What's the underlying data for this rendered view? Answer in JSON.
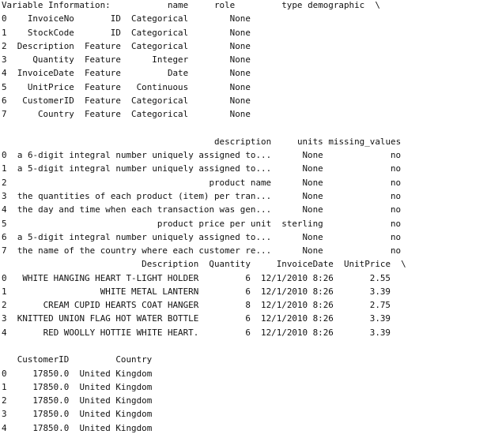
{
  "variable_info": {
    "title": "Variable Information:",
    "columns": [
      "name",
      "role",
      "type",
      "demographic"
    ],
    "continuation": "\\",
    "index": [
      "0",
      "1",
      "2",
      "3",
      "4",
      "5",
      "6",
      "7"
    ],
    "rows": [
      [
        "InvoiceNo",
        "ID",
        "Categorical",
        "None"
      ],
      [
        "StockCode",
        "ID",
        "Categorical",
        "None"
      ],
      [
        "Description",
        "Feature",
        "Categorical",
        "None"
      ],
      [
        "Quantity",
        "Feature",
        "Integer",
        "None"
      ],
      [
        "InvoiceDate",
        "Feature",
        "Date",
        "None"
      ],
      [
        "UnitPrice",
        "Feature",
        "Continuous",
        "None"
      ],
      [
        "CustomerID",
        "Feature",
        "Categorical",
        "None"
      ],
      [
        "Country",
        "Feature",
        "Categorical",
        "None"
      ]
    ]
  },
  "variable_info_cont": {
    "columns": [
      "description",
      "units",
      "missing_values"
    ],
    "index": [
      "0",
      "1",
      "2",
      "3",
      "4",
      "5",
      "6",
      "7"
    ],
    "rows": [
      [
        "a 6-digit integral number uniquely assigned to...",
        "None",
        "no"
      ],
      [
        "a 5-digit integral number uniquely assigned to...",
        "None",
        "no"
      ],
      [
        "product name",
        "None",
        "no"
      ],
      [
        "the quantities of each product (item) per tran...",
        "None",
        "no"
      ],
      [
        "the day and time when each transaction was gen...",
        "None",
        "no"
      ],
      [
        "product price per unit",
        "sterling",
        "no"
      ],
      [
        "a 5-digit integral number uniquely assigned to...",
        "None",
        "no"
      ],
      [
        "the name of the country where each customer re...",
        "None",
        "no"
      ]
    ]
  },
  "head": {
    "columns": [
      "Description",
      "Quantity",
      "InvoiceDate",
      "UnitPrice"
    ],
    "continuation": "\\",
    "index": [
      "0",
      "1",
      "2",
      "3",
      "4"
    ],
    "rows": [
      [
        "WHITE HANGING HEART T-LIGHT HOLDER",
        "6",
        "12/1/2010 8:26",
        "2.55"
      ],
      [
        "WHITE METAL LANTERN",
        "6",
        "12/1/2010 8:26",
        "3.39"
      ],
      [
        "CREAM CUPID HEARTS COAT HANGER",
        "8",
        "12/1/2010 8:26",
        "2.75"
      ],
      [
        "KNITTED UNION FLAG HOT WATER BOTTLE",
        "6",
        "12/1/2010 8:26",
        "3.39"
      ],
      [
        "RED WOOLLY HOTTIE WHITE HEART.",
        "6",
        "12/1/2010 8:26",
        "3.39"
      ]
    ]
  },
  "head_cont": {
    "columns": [
      "CustomerID",
      "Country"
    ],
    "index": [
      "0",
      "1",
      "2",
      "3",
      "4"
    ],
    "rows": [
      [
        "17850.0",
        "United Kingdom"
      ],
      [
        "17850.0",
        "United Kingdom"
      ],
      [
        "17850.0",
        "United Kingdom"
      ],
      [
        "17850.0",
        "United Kingdom"
      ],
      [
        "17850.0",
        "United Kingdom"
      ]
    ]
  }
}
